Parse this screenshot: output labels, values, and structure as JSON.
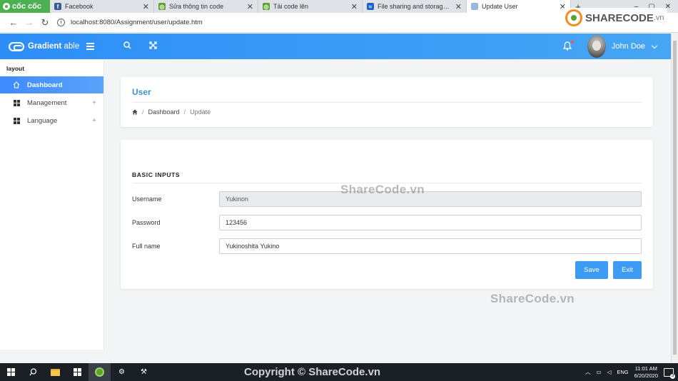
{
  "browser": {
    "logo_text": "cốc cốc",
    "tabs": [
      {
        "label": "Facebook",
        "icon": "facebook-icon",
        "color": "#3b5998"
      },
      {
        "label": "Sửa thông tin code",
        "icon": "sharecode-icon",
        "color": "#5ba32b"
      },
      {
        "label": "Tải code lên",
        "icon": "sharecode-icon",
        "color": "#5ba32b"
      },
      {
        "label": "File sharing and storage mad",
        "icon": "mediafire-icon",
        "color": "#1d64c8"
      },
      {
        "label": "Update User",
        "icon": "page-icon",
        "color": "#9ab8d8"
      }
    ],
    "url": "localhost:8080/Assignment/user/update.htm",
    "new_tab": "+",
    "window_controls": [
      "–",
      "▢",
      "✕"
    ]
  },
  "header": {
    "brand_bold": "Gradient",
    "brand_light": " able",
    "user_name": "John Doe",
    "gradient_start": "#2d8ef8",
    "gradient_end": "#46a6f4"
  },
  "sidebar": {
    "caption": "layout",
    "items": [
      {
        "label": "Dashboard",
        "icon": "home-icon"
      },
      {
        "label": "Management",
        "icon": "grid-icon"
      },
      {
        "label": "Language",
        "icon": "grid-icon"
      }
    ],
    "accent": "#3d8bfd"
  },
  "page": {
    "title": "User",
    "breadcrumb": {
      "home_icon": "home-icon",
      "dashboard": "Dashboard",
      "current": "Update"
    }
  },
  "form": {
    "section_title": "BASIC INPUTS",
    "fields": [
      {
        "label": "Username",
        "value": "Yukinon",
        "readonly": true
      },
      {
        "label": "Password",
        "value": "123456",
        "readonly": false
      },
      {
        "label": "Full name",
        "value": "Yukinoshita Yukino",
        "readonly": false
      }
    ],
    "save_label": "Save",
    "exit_label": "Exit",
    "button_color": "#3d9bf4"
  },
  "watermarks": {
    "wm1": "ShareCode.vn",
    "wm2": "ShareCode.vn",
    "copyright": "Copyright © ShareCode.vn",
    "logo_main": "SHARECODE",
    "logo_suffix": ".vn"
  },
  "taskbar": {
    "time": "11:01 AM",
    "date": "6/20/2020",
    "lang": "ENG",
    "notifications": "3"
  }
}
